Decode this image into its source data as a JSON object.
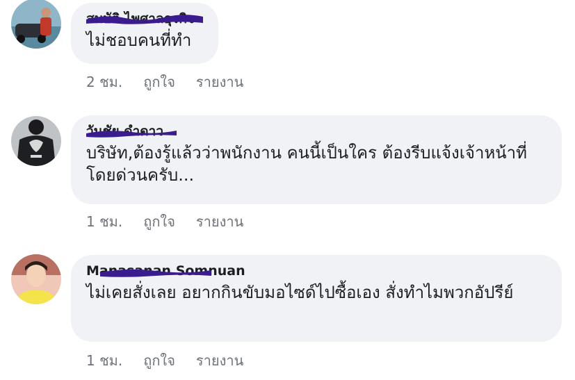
{
  "comments": [
    {
      "author": "สมบัติ ไพศาลธุรกิจ",
      "text": "ไม่ชอบคนที่ทำ",
      "time": "2 ชม.",
      "like": "ถูกใจ",
      "report": "รายงาน"
    },
    {
      "author": "วันชัย ดำดาว",
      "text": "บริษัท,ต้องรู้แล้วว่าพนักงาน คนนี้เป็นใคร ต้องรีบแจ้งเจ้าหน้าที่โดยด่วนครับ...",
      "time": "1 ชม.",
      "like": "ถูกใจ",
      "report": "รายงาน"
    },
    {
      "author": "Manasanan Somnuan",
      "text": "ไม่เคยสั่งเลย อยากกินขับมอไซด์ไปซื้อเอง สั่งทำไมพวกอัปรีย์",
      "time": "1 ชม.",
      "like": "ถูกใจ",
      "report": "รายงาน"
    }
  ],
  "colors": {
    "bubble": "#f0f2f5",
    "meta_text": "#6d7278",
    "redaction_scribble": "#3b1c8f"
  }
}
